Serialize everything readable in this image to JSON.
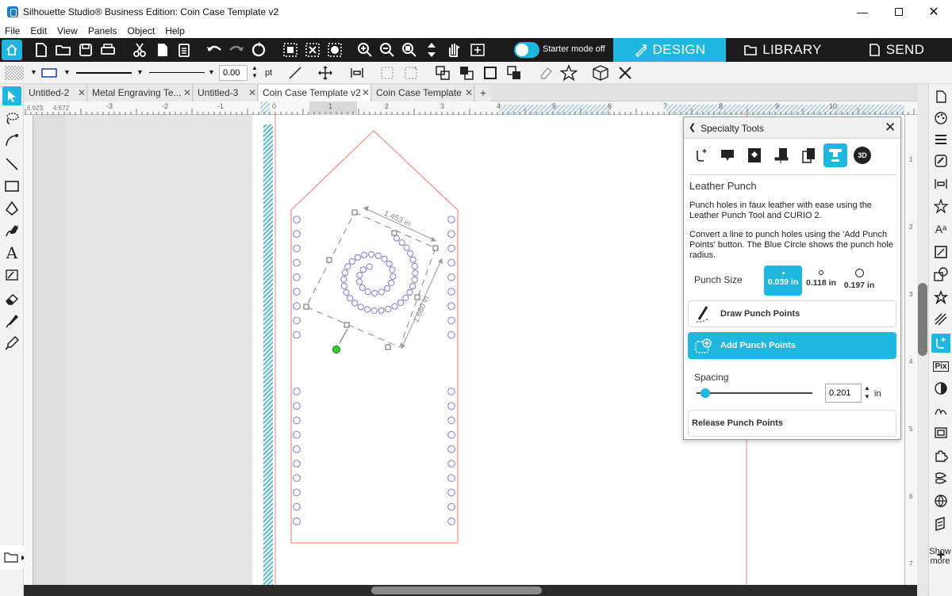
{
  "window": {
    "title": "Silhouette Studio® Business Edition: Coin Case Template v2"
  },
  "menu": [
    "File",
    "Edit",
    "View",
    "Panels",
    "Object",
    "Help"
  ],
  "toolbar": {
    "starter_mode_label": "Starter mode off",
    "modes": {
      "design": "DESIGN",
      "library": "LIBRARY",
      "send": "SEND"
    }
  },
  "props": {
    "stroke_width": "0.00",
    "stroke_unit": "pt"
  },
  "coords": {
    "x": "6.923",
    "y": "4.672"
  },
  "tabs": [
    {
      "label": "Untitled-2",
      "active": false
    },
    {
      "label": "Metal Engraving Te...",
      "active": false
    },
    {
      "label": "Untitled-3",
      "active": false
    },
    {
      "label": "Coin Case Template v2",
      "active": true
    },
    {
      "label": "Coin Case Template",
      "active": false
    }
  ],
  "ruler": {
    "top": [
      "-3",
      "-2",
      "-1",
      "0",
      "1",
      "2",
      "3",
      "4",
      "5",
      "6",
      "7",
      "8",
      "9",
      "10"
    ],
    "right": [
      "1",
      "2",
      "3",
      "4",
      "5",
      "6",
      "7"
    ]
  },
  "canvas": {
    "dim_width": "1.453 in",
    "dim_height": "1.680 in"
  },
  "panel": {
    "title": "Specialty Tools",
    "tool_name": "Leather Punch",
    "desc1": "Punch holes in faux leather with ease using the Leather Punch Tool and CURIO 2.",
    "desc2": "Convert a line to punch holes using the 'Add Punch Points' button. The Blue Circle shows the punch hole radius.",
    "punch_size_label": "Punch Size",
    "sizes": [
      "0.039 in",
      "0.118 in",
      "0.197 in"
    ],
    "draw_button": "Draw Punch Points",
    "add_button": "Add Punch Points",
    "spacing_label": "Spacing",
    "spacing_value": "0.201",
    "spacing_unit": "in",
    "spacing_fraction": 0.03,
    "release_button": "Release Punch Points"
  },
  "sidebar": {
    "show_more": "Show more"
  },
  "colors": {
    "accent": "#1fb6df",
    "cut_line": "#f08a80",
    "punch": "#7b7bd8"
  }
}
